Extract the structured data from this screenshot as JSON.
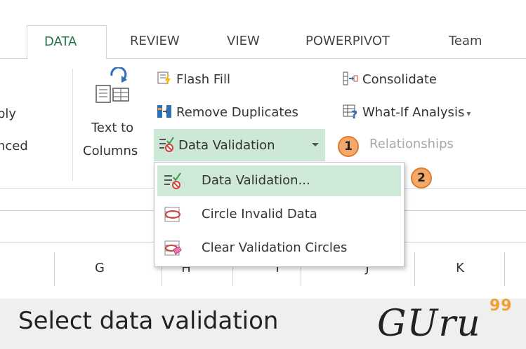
{
  "tabs": {
    "active": "DATA",
    "others": [
      "REVIEW",
      "VIEW",
      "POWERPIVOT",
      "Team"
    ]
  },
  "ribbon": {
    "left_fragments": [
      "ply",
      "nced"
    ],
    "text_to_columns": [
      "Text to",
      "Columns"
    ],
    "flash_fill": "Flash Fill",
    "remove_duplicates": "Remove Duplicates",
    "data_validation": "Data Validation",
    "consolidate": "Consolidate",
    "what_if": "What-If Analysis",
    "relationships": "Relationships"
  },
  "menu": {
    "items": [
      "Data Validation...",
      "Circle Invalid Data",
      "Clear Validation Circles"
    ]
  },
  "badges": [
    "1",
    "2"
  ],
  "columns": [
    "G",
    "H",
    "I",
    "J",
    "K"
  ],
  "footer": {
    "caption": "Select data validation",
    "logo": "GUru",
    "logo_sup": "99"
  },
  "colors": {
    "accent": "#217346",
    "highlight": "#cfe9d9",
    "badge": "#f4a96b",
    "logo_sup": "#f0a030"
  }
}
